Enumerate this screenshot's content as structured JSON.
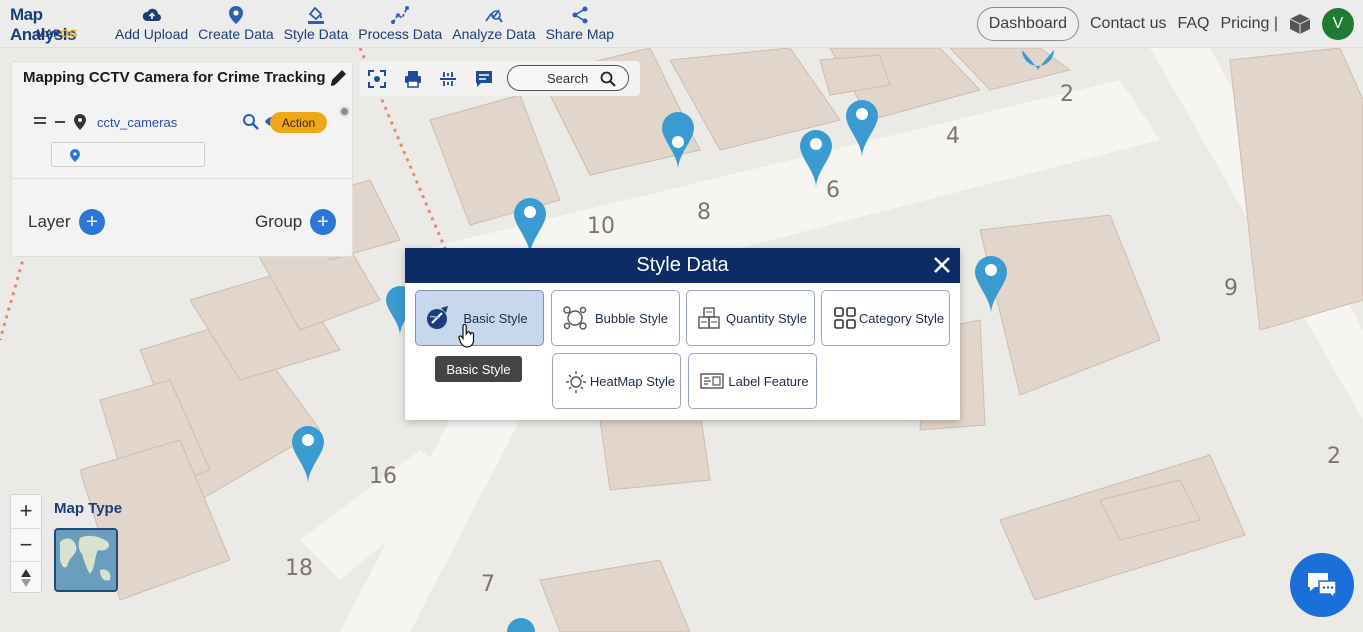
{
  "logo": {
    "line1": "Map Analysis",
    "line2_a": "MAP",
    "line2_b": "OG"
  },
  "menu": [
    {
      "label": "Add Upload",
      "icon": "cloud-upload-icon"
    },
    {
      "label": "Create Data",
      "icon": "map-pin-icon"
    },
    {
      "label": "Style Data",
      "icon": "paint-bucket-icon"
    },
    {
      "label": "Process Data",
      "icon": "process-icon"
    },
    {
      "label": "Analyze Data",
      "icon": "analyze-icon"
    },
    {
      "label": "Share Map",
      "icon": "share-icon"
    }
  ],
  "nav": {
    "dashboard": "Dashboard",
    "contact": "Contact us",
    "faq": "FAQ",
    "pricing": "Pricing |",
    "avatar": "V"
  },
  "layer_panel": {
    "title": "Mapping CCTV Camera for Crime Tracking",
    "layer_name": "cctv_cameras",
    "action_label": "Action",
    "layer_label": "Layer",
    "group_label": "Group"
  },
  "toolbar": {
    "search_label": "Search"
  },
  "map_numbers": [
    "2",
    "4",
    "6",
    "8",
    "10",
    "9",
    "16",
    "18",
    "7",
    "2"
  ],
  "map_type_label": "Map Type",
  "modal": {
    "title": "Style Data",
    "buttons": [
      {
        "label": "Basic Style",
        "icon": "basic-style-icon",
        "active": true
      },
      {
        "label": "Bubble Style",
        "icon": "bubble-style-icon"
      },
      {
        "label": "Quantity Style",
        "icon": "quantity-style-icon"
      },
      {
        "label": "Category Style",
        "icon": "category-style-icon"
      },
      {
        "label": "HeatMap Style",
        "icon": "heatmap-style-icon"
      },
      {
        "label": "Label Feature",
        "icon": "label-feature-icon"
      }
    ],
    "tooltip": "Basic Style"
  },
  "colors": {
    "navy": "#0d2c66",
    "accent_blue": "#2b76d6",
    "action": "#f0a818",
    "marker": "#3a9bd0"
  }
}
